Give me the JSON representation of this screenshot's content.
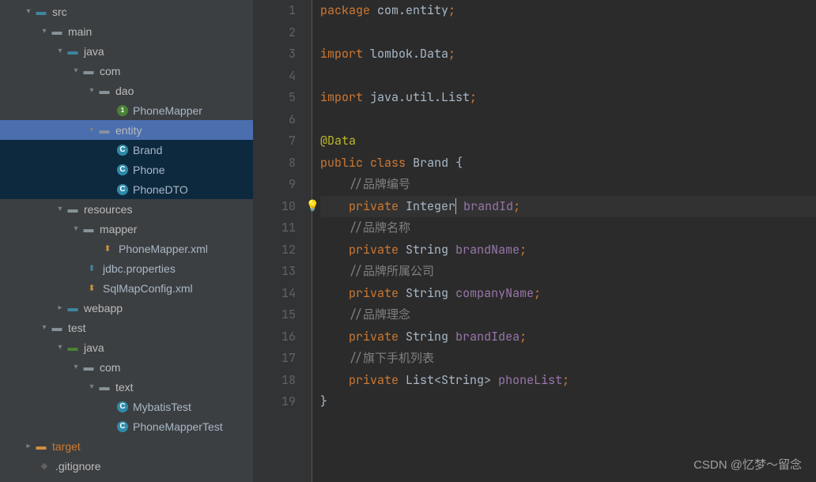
{
  "tree": {
    "src": "src",
    "main": "main",
    "java": "java",
    "com": "com",
    "dao": "dao",
    "phoneMapper": "PhoneMapper",
    "entity": "entity",
    "brand": "Brand",
    "phone": "Phone",
    "phoneDTO": "PhoneDTO",
    "resources": "resources",
    "mapper": "mapper",
    "phoneMapperXml": "PhoneMapper.xml",
    "jdbcProperties": "jdbc.properties",
    "sqlMapConfig": "SqlMapConfig.xml",
    "webapp": "webapp",
    "test": "test",
    "text": "text",
    "mybatisTest": "MybatisTest",
    "phoneMapperTest": "PhoneMapperTest",
    "target": "target",
    "gitignore": ".gitignore"
  },
  "gutter": [
    "1",
    "2",
    "3",
    "4",
    "5",
    "6",
    "7",
    "8",
    "9",
    "10",
    "11",
    "12",
    "13",
    "14",
    "15",
    "16",
    "17",
    "18",
    "19"
  ],
  "code": {
    "l1": {
      "kw": "package",
      "pkg": " com.entity",
      "semi": ";"
    },
    "l3": {
      "kw": "import",
      "pkg": " lombok.",
      "cls": "Data",
      "semi": ";"
    },
    "l5": {
      "kw": "import",
      "pkg": " java.util.List",
      "semi": ";"
    },
    "l7": {
      "ann": "@Data"
    },
    "l8": {
      "pub": "public",
      "cls": "class",
      "name": "Brand",
      "brace": "{"
    },
    "l9": {
      "cmt": "//品牌编号"
    },
    "l10": {
      "priv": "private",
      "type": "Integer",
      "field": "brandId",
      "semi": ";"
    },
    "l11": {
      "cmt": "//品牌名称"
    },
    "l12": {
      "priv": "private",
      "type": "String",
      "field": "brandName",
      "semi": ";"
    },
    "l13": {
      "cmt": "//品牌所属公司"
    },
    "l14": {
      "priv": "private",
      "type": "String",
      "field": "companyName",
      "semi": ";"
    },
    "l15": {
      "cmt": "//品牌理念"
    },
    "l16": {
      "priv": "private",
      "type": "String",
      "field": "brandIdea",
      "semi": ";"
    },
    "l17": {
      "cmt": "//旗下手机列表"
    },
    "l18": {
      "priv": "private",
      "type": "List<String>",
      "field": "phoneList",
      "semi": ";"
    },
    "l19": {
      "brace": "}"
    }
  },
  "watermark": "CSDN @忆梦～留念"
}
